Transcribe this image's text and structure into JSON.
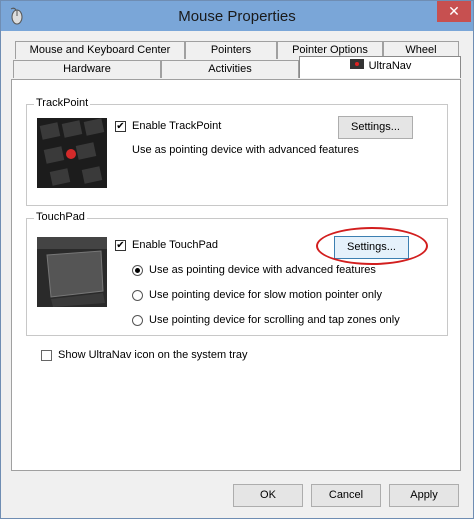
{
  "window": {
    "title": "Mouse Properties",
    "close_glyph": "✕"
  },
  "tabs_row1": [
    {
      "label": "Mouse and Keyboard Center"
    },
    {
      "label": "Pointers"
    },
    {
      "label": "Pointer Options"
    },
    {
      "label": "Wheel"
    }
  ],
  "tabs_row2": [
    {
      "label": "Hardware"
    },
    {
      "label": "Activities"
    },
    {
      "label": "UltraNav",
      "active": true
    }
  ],
  "trackpoint": {
    "group_label": "TrackPoint",
    "enable_label": "Enable TrackPoint",
    "enable_checked": true,
    "description": "Use as pointing device with advanced features",
    "settings_label": "Settings..."
  },
  "touchpad": {
    "group_label": "TouchPad",
    "enable_label": "Enable TouchPad",
    "enable_checked": true,
    "settings_label": "Settings...",
    "options": [
      {
        "label": "Use as pointing device with advanced features",
        "selected": true
      },
      {
        "label": "Use pointing device for slow motion pointer only",
        "selected": false
      },
      {
        "label": "Use pointing device for scrolling and tap zones only",
        "selected": false
      }
    ]
  },
  "tray": {
    "label": "Show UltraNav icon on the system tray",
    "checked": false
  },
  "buttons": {
    "ok": "OK",
    "cancel": "Cancel",
    "apply": "Apply"
  },
  "colors": {
    "titlebar": "#7aa6d8",
    "close": "#c75050",
    "highlight": "#d21e1e"
  }
}
